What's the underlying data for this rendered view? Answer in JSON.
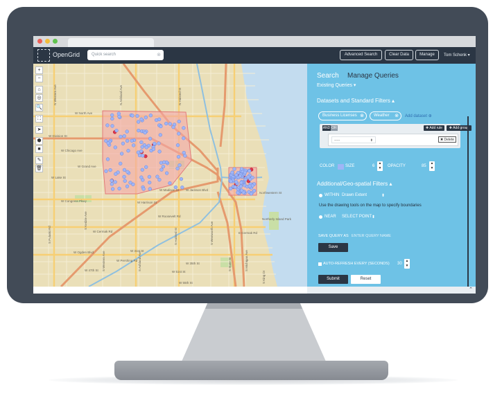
{
  "brand": {
    "name": "OpenGrid"
  },
  "navbar": {
    "search_placeholder": "Quick search",
    "buttons": [
      "Advanced Search",
      "Clear Data",
      "Manage"
    ],
    "user": "Tom Schenk ▾"
  },
  "map": {
    "tools": [
      "+",
      "−",
      "⌂",
      "◎",
      "🔍",
      "⛶",
      "➤",
      "⬢",
      "■",
      "✎",
      "🗑"
    ],
    "streets_h": [
      "W North Ave",
      "W Division St",
      "W Chicago Ave",
      "W Grand Ave",
      "W Lake St",
      "W Madison St",
      "W Jackson Blvd",
      "W Harrison St",
      "W Roosevelt Rd",
      "W Cermak Rd",
      "W 31st St",
      "W 35th St",
      "W 47th St",
      "W 51st St",
      "W 55th St",
      "E Cermak Rd",
      "W Congress Pkwy"
    ],
    "streets_v": [
      "N Western Ave",
      "N Ashland Ave",
      "N Halsted St",
      "S Pulaski Rd",
      "S Kedzie Ave",
      "S Western Ave",
      "S Ashland Ave",
      "S Halsted St",
      "S Wentworth Ave",
      "S State St",
      "S Michigan Ave",
      "S King Dr"
    ],
    "places": [
      "Northerly Island Park",
      "Northwestern St",
      "W Ogden Blvd",
      "W Pershing Rd"
    ]
  },
  "panel": {
    "tabs": [
      "Search",
      "Manage Queries"
    ],
    "existing_queries": "Existing Queries ▾",
    "datasets_heading": "Datasets and Standard Filters ▴",
    "datasets": [
      "Business Licenses",
      "Weather"
    ],
    "add_dataset": "Add dataset ⊕",
    "and_label": "AND",
    "or_label": "OR",
    "add_rule": "✚ Add rule",
    "add_group": "✚ Add group",
    "rule_select": "-----",
    "delete": "✖ Delete",
    "color_label": "COLOR",
    "size_label": "SIZE",
    "size_value": "6",
    "opacity_label": "OPACITY",
    "opacity_value": "85",
    "geo_heading": "Additional/Geo-spatial Filters ▴",
    "within_label": "WITHIN",
    "within_value": "Drawn Extent",
    "draw_hint": "Use the drawing tools on the map to specify boundaries",
    "near_label": "NEAR",
    "near_value": "SELECT POINT",
    "save_query_label": "SAVE QUERY AS",
    "save_query_placeholder": "ENTER QUERY NAME",
    "save": "Save",
    "auto_refresh": "AUTO-REFRESH EVERY (SECONDS)",
    "refresh_value": "30",
    "submit": "Submit",
    "reset": "Reset"
  },
  "colors": {
    "accent": "#6ec2e6",
    "navbar": "#2b3644",
    "selection": "#f3a7a7",
    "point": "#9fb5f6",
    "highlight": "#e0344a"
  }
}
